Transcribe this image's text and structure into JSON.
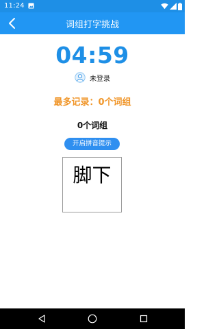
{
  "status_bar": {
    "time": "11:24",
    "icons": [
      "gallery-icon",
      "wifi-icon",
      "signal-icon",
      "battery-icon"
    ]
  },
  "app_bar": {
    "title": "词组打字挑战",
    "back_icon": "chevron-left-icon"
  },
  "timer": "04:59",
  "user": {
    "avatar_icon": "avatar-icon",
    "login_status": "未登录"
  },
  "record": "最多记录：0个词组",
  "count": "0个词组",
  "pinyin_button_label": "开启拼音提示",
  "current_word": "脚下",
  "nav_bar": {
    "icons": [
      "back-triangle-icon",
      "home-circle-icon",
      "recents-square-icon"
    ]
  },
  "colors": {
    "primary": "#2196f3",
    "status_bar": "#1e8fe6",
    "timer": "#1e8fe6",
    "record": "#f0962a",
    "button": "#2f8ff0"
  }
}
